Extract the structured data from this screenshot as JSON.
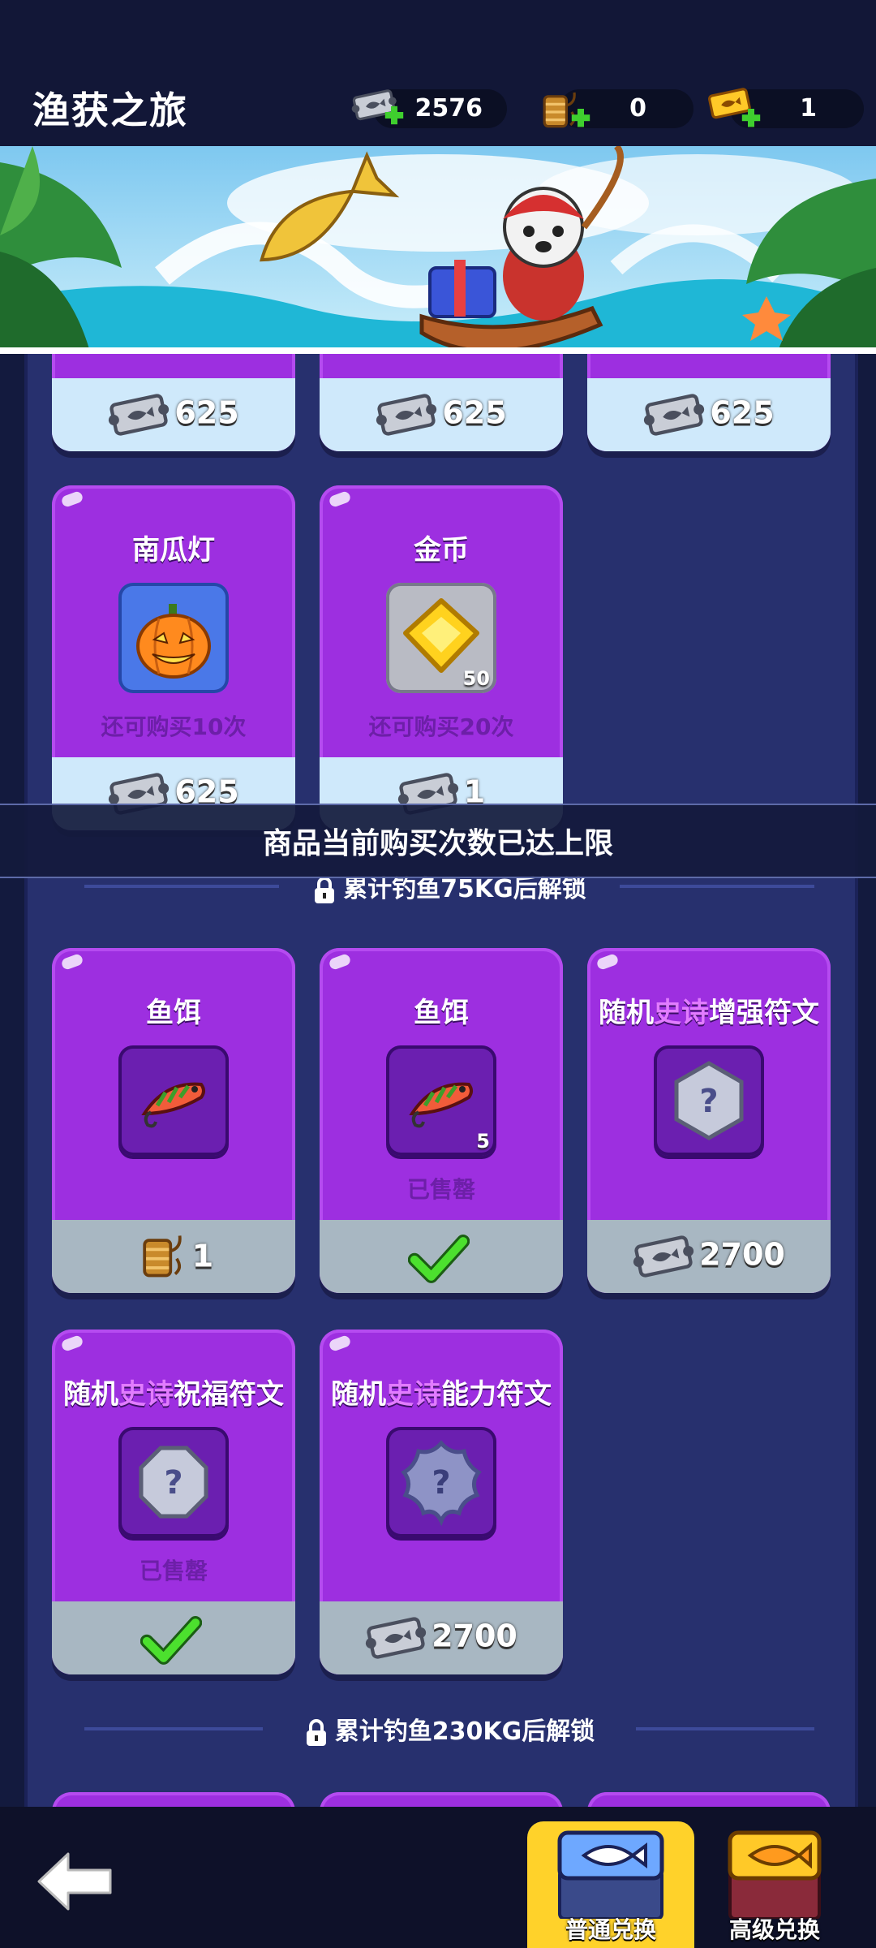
{
  "header": {
    "title": "渔获之旅",
    "currencies": [
      {
        "icon": "fish-ticket-icon",
        "value": "2576"
      },
      {
        "icon": "fishing-line-spool-icon",
        "value": "0"
      },
      {
        "icon": "gold-fish-ticket-icon",
        "value": "1"
      }
    ]
  },
  "shop": {
    "row0": [
      {
        "price": "625",
        "price_icon": "fish-ticket-icon"
      },
      {
        "price": "625",
        "price_icon": "fish-ticket-icon"
      },
      {
        "price": "625",
        "price_icon": "fish-ticket-icon"
      }
    ],
    "row1": [
      {
        "title": "南瓜灯",
        "icon": "pumpkin-lantern-icon",
        "status": "还可购买10次",
        "price": "625",
        "price_icon": "fish-ticket-icon"
      },
      {
        "title": "金币",
        "icon": "gold-coin-icon",
        "qty": "50",
        "status": "还可购买20次",
        "price": "1",
        "price_icon": "fish-ticket-icon"
      }
    ],
    "lock1": "累计钓鱼75KG后解锁",
    "row2": [
      {
        "title": "鱼饵",
        "icon": "lure-icon",
        "price": "1",
        "price_icon": "fishing-line-spool-icon"
      },
      {
        "title": "鱼饵",
        "icon": "lure-icon",
        "qty": "5",
        "status": "已售罄",
        "sold_icon": "checkmark-icon"
      },
      {
        "title_pre": "随机",
        "title_epic": "史诗",
        "title_post": "增强符文",
        "icon": "hexagon-rune-icon",
        "price": "2700",
        "price_icon": "fish-ticket-icon"
      }
    ],
    "row3": [
      {
        "title_pre": "随机",
        "title_epic": "史诗",
        "title_post": "祝福符文",
        "icon": "octagon-rune-icon",
        "status": "已售罄",
        "sold_icon": "checkmark-icon"
      },
      {
        "title_pre": "随机",
        "title_epic": "史诗",
        "title_post": "能力符文",
        "icon": "star-rune-icon",
        "price": "2700",
        "price_icon": "fish-ticket-icon"
      }
    ],
    "lock2": "累计钓鱼230KG后解锁"
  },
  "toast": "商品当前购买次数已达上限",
  "nav": {
    "back_icon": "back-arrow-icon",
    "tabs": [
      {
        "label": "普通兑换",
        "icon": "fish-shop-icon",
        "active": true
      },
      {
        "label": "高级兑换",
        "icon": "gold-fish-shop-icon",
        "active": false
      }
    ]
  },
  "colors": {
    "card": "#9d2fe0",
    "active_tab": "#ffd22a",
    "epic_text": "#e27cff",
    "sold_status": "#6d1fa8"
  }
}
